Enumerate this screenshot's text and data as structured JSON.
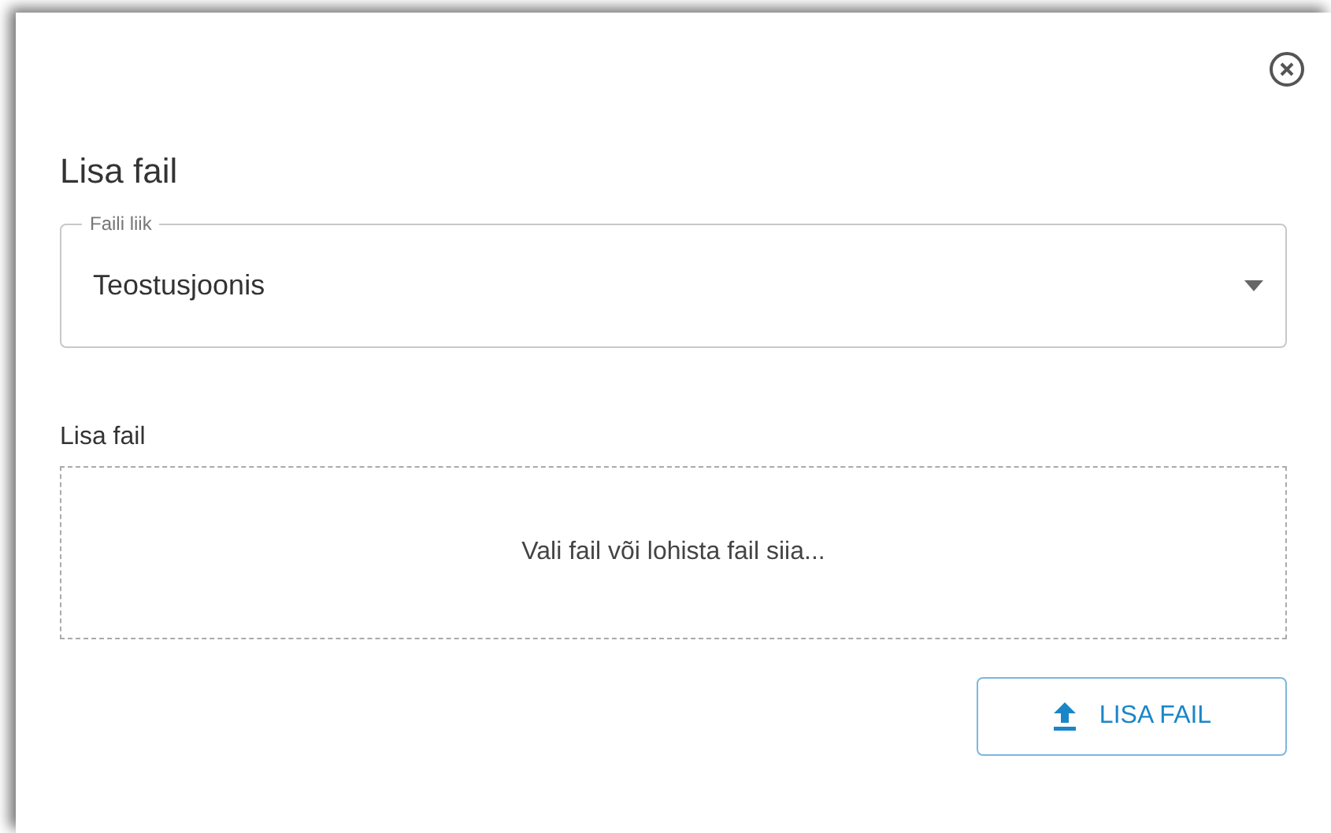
{
  "dialog": {
    "title": "Lisa fail"
  },
  "file_type": {
    "label": "Faili liik",
    "value": "Teostusjoonis"
  },
  "upload": {
    "label": "Lisa fail",
    "dropzone_text": "Vali fail või lohista fail siia..."
  },
  "button": {
    "label": "LISA FAIL"
  }
}
